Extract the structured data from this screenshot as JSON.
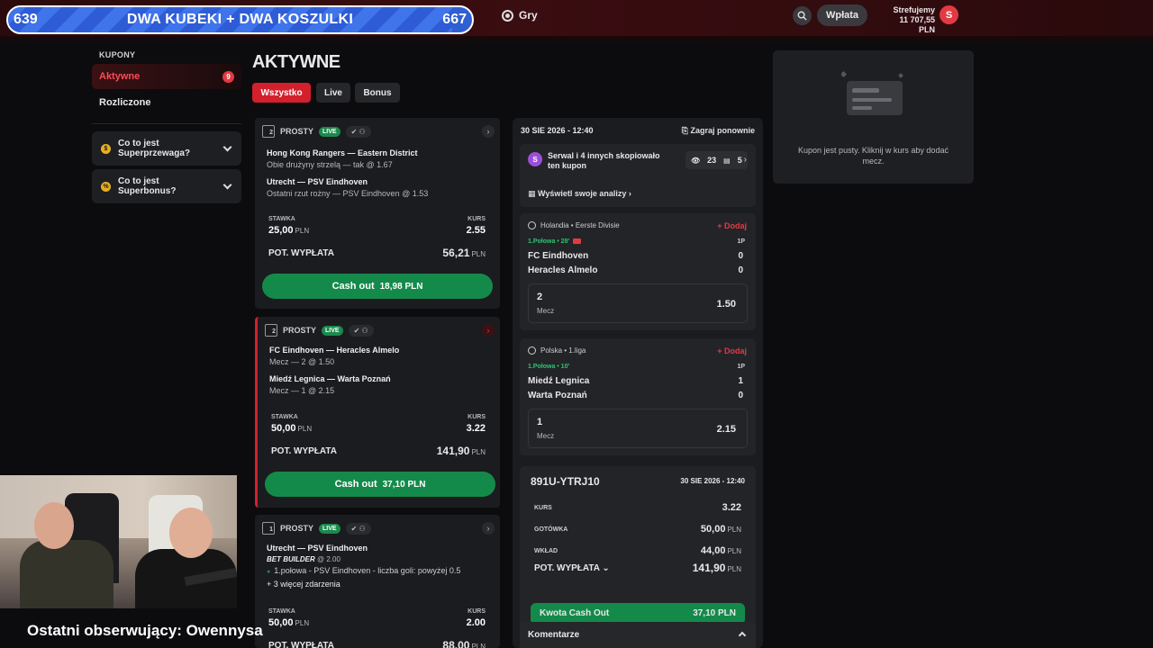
{
  "overlay": {
    "progress_left": "639",
    "progress_title": "DWA KUBEKI + DWA KOSZULKI",
    "progress_right": "667",
    "progress_fraction": 0.958,
    "last_follower": "Ostatni obserwujący: Owennysa"
  },
  "header": {
    "games_label": "Gry",
    "deposit_label": "Wpłata",
    "balance_label": "Strefujemy",
    "balance_amount": "11 707,55 PLN",
    "coin_symbol": "S"
  },
  "sidebar": {
    "section_label": "KUPONY",
    "active_label": "Aktywne",
    "active_count": "9",
    "settled_label": "Rozliczone",
    "faq": [
      {
        "icon": "$",
        "text": "Co to jest Superprzewaga?"
      },
      {
        "icon": "%",
        "text": "Co to jest Superbonus?"
      }
    ]
  },
  "main": {
    "title": "AKTYWNE",
    "filters": {
      "all": "Wszystko",
      "live": "Live",
      "bonus": "Bonus"
    },
    "coupons": [
      {
        "count": "2",
        "type": "PROSTY",
        "live": "LIVE",
        "events": [
          {
            "title": "Hong Kong Rangers — Eastern District",
            "sub": "Obie drużyny strzelą — tak @ 1.67"
          },
          {
            "title": "Utrecht — PSV Eindhoven",
            "sub": "Ostatni rzut rożny — PSV Eindhoven @ 1.53"
          }
        ],
        "stake_label": "STAWKA",
        "stake": "25,00",
        "odds_label": "KURS",
        "odds": "2.55",
        "payout_label": "POT. WYPŁATA",
        "payout": "56,21",
        "cashout_label": "Cash out",
        "cashout_amount": "18,98",
        "currency": "PLN"
      },
      {
        "count": "2",
        "type": "PROSTY",
        "live": "LIVE",
        "events": [
          {
            "title": "FC Eindhoven — Heracles Almelo",
            "sub": "Mecz — 2 @ 1.50"
          },
          {
            "title": "Miedź Legnica — Warta Poznań",
            "sub": "Mecz — 1 @ 2.15"
          }
        ],
        "stake_label": "STAWKA",
        "stake": "50,00",
        "odds_label": "KURS",
        "odds": "3.22",
        "payout_label": "POT. WYPŁATA",
        "payout": "141,90",
        "cashout_label": "Cash out",
        "cashout_amount": "37,10",
        "currency": "PLN"
      },
      {
        "count": "1",
        "type": "PROSTY",
        "live": "LIVE",
        "event_title": "Utrecht — PSV Eindhoven",
        "bet_builder": "BET BUILDER",
        "bet_builder_odds": "@ 2.00",
        "leg": "1.połowa - PSV Eindhoven - liczba goli: powyżej 0.5",
        "more": "+ 3 więcej zdarzenia",
        "stake_label": "STAWKA",
        "stake": "50,00",
        "odds_label": "KURS",
        "odds": "2.00",
        "payout_label": "POT. WYPŁATA",
        "payout": "88,00",
        "currency": "PLN"
      }
    ]
  },
  "detail": {
    "date": "30 SIE 2026 - 12:40",
    "replay": "Zagraj ponownie",
    "copy_avatar": "S",
    "copy_text": "Serwal i 4 innych skopiowało ten kupon",
    "views": "23",
    "copies": "5",
    "analysis_link": "Wyświetl swoje analizy ›",
    "matches": [
      {
        "league": "Holandia • Eerste Divisie",
        "add": "+ Dodaj",
        "time": "1.Połowa • 28'",
        "period": "1P",
        "home": "FC Eindhoven",
        "home_score": "0",
        "away": "Heracles Almelo",
        "away_score": "0",
        "selection": "2",
        "market": "Mecz",
        "odds": "1.50"
      },
      {
        "league": "Polska • 1.liga",
        "add": "+ Dodaj",
        "time": "1.Połowa • 10'",
        "period": "1P",
        "home": "Miedź Legnica",
        "home_score": "1",
        "away": "Warta Poznań",
        "away_score": "0",
        "selection": "1",
        "market": "Mecz",
        "odds": "2.15"
      }
    ],
    "summary": {
      "id": "891U-YTRJ10",
      "date": "30 SIE 2026 - 12:40",
      "odds_label": "KURS",
      "odds": "3.22",
      "cash_label": "GOTÓWKA",
      "cash": "50,00",
      "stake_label": "WKŁAD",
      "stake": "44,00",
      "payout_label": "POT. WYPŁATA",
      "payout": "141,90",
      "cashout_label": "Kwota Cash Out",
      "cashout": "37,10",
      "currency": "PLN"
    },
    "comments": "Komentarze"
  },
  "betslip": {
    "empty_text": "Kupon jest pusty. Kliknij w kurs aby dodać mecz."
  }
}
